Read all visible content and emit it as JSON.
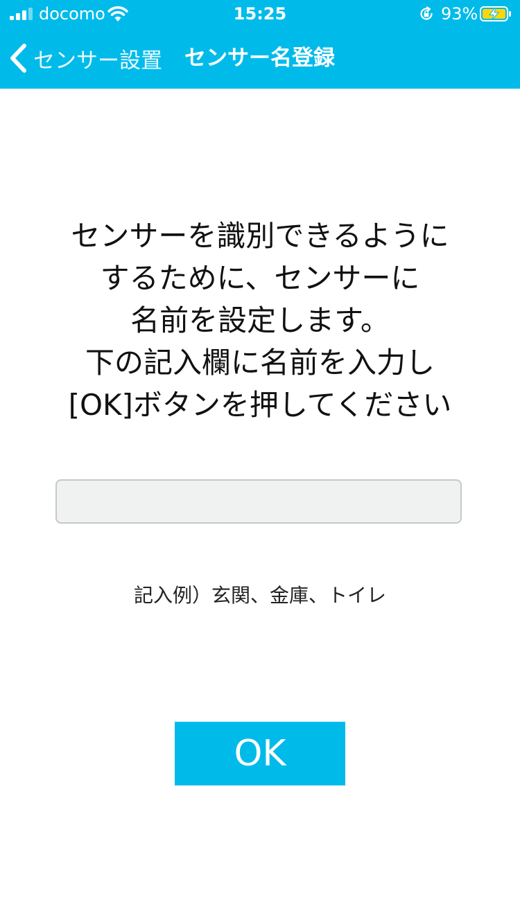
{
  "status_bar": {
    "carrier": "docomo",
    "time": "15:25",
    "battery_percent": "93%",
    "signal_icon": "signal-bars-icon",
    "wifi_icon": "wifi-icon",
    "orientation_lock_icon": "orientation-lock-icon",
    "battery_icon": "battery-charging-icon"
  },
  "nav": {
    "back_label": "センサー設置",
    "title": "センサー名登録",
    "back_icon": "chevron-left-icon"
  },
  "instruction": {
    "lines": [
      "センサーを識別できるように",
      "するために、センサーに",
      "名前を設定します。",
      "下の記入欄に名前を入力し",
      "[OK]ボタンを押してください"
    ]
  },
  "name_input": {
    "value": "",
    "placeholder": ""
  },
  "example_text": "記入例）玄関、金庫、トイレ",
  "ok_button": {
    "label": "OK"
  },
  "colors": {
    "accent": "#00bbea",
    "input_bg": "#eff2f1",
    "input_border": "#c6c8c7",
    "battery_fill": "#ffd60a"
  }
}
